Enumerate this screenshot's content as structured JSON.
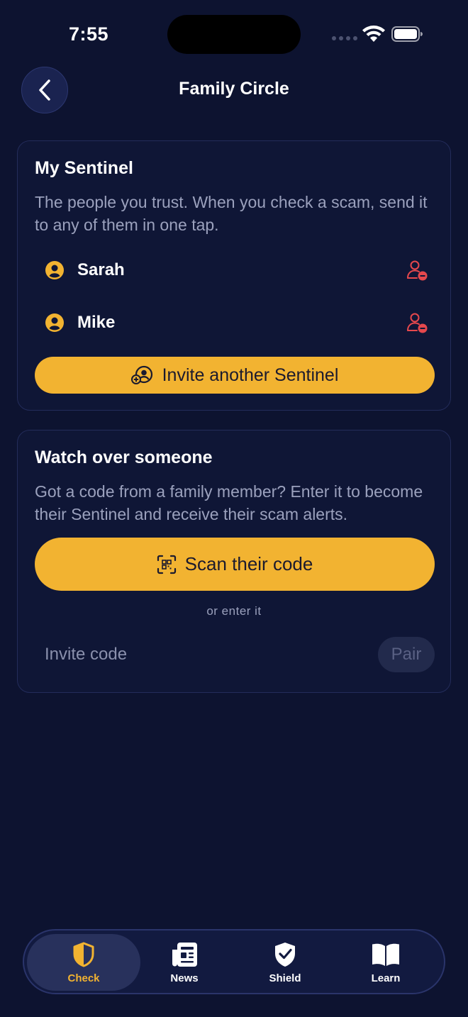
{
  "status_bar": {
    "time": "7:55"
  },
  "header": {
    "title": "Family Circle"
  },
  "my_sentinel": {
    "title": "My Sentinel",
    "description": "The people you trust. When you check a scam, send it to any of them in one tap.",
    "members": [
      {
        "name": "Sarah"
      },
      {
        "name": "Mike"
      }
    ],
    "invite_button_label": "Invite another Sentinel"
  },
  "watch_over": {
    "title": "Watch over someone",
    "description": "Got a code from a family member? Enter it to become their Sentinel and receive their scam alerts.",
    "scan_button_label": "Scan their code",
    "or_enter_label": "or enter it",
    "invite_code": {
      "value": "",
      "placeholder": "Invite code"
    },
    "pair_button_label": "Pair"
  },
  "tab_bar": {
    "active": "Check",
    "tabs": [
      {
        "label": "Check",
        "icon": "shield-half-icon"
      },
      {
        "label": "News",
        "icon": "newspaper-icon"
      },
      {
        "label": "Shield",
        "icon": "shield-check-icon"
      },
      {
        "label": "Learn",
        "icon": "book-icon"
      }
    ]
  },
  "colors": {
    "background": "#0d1330",
    "card_background": "#0f1636",
    "accent": "#f2b331",
    "remove": "#e5484d",
    "muted_text": "#9ba1bd"
  }
}
